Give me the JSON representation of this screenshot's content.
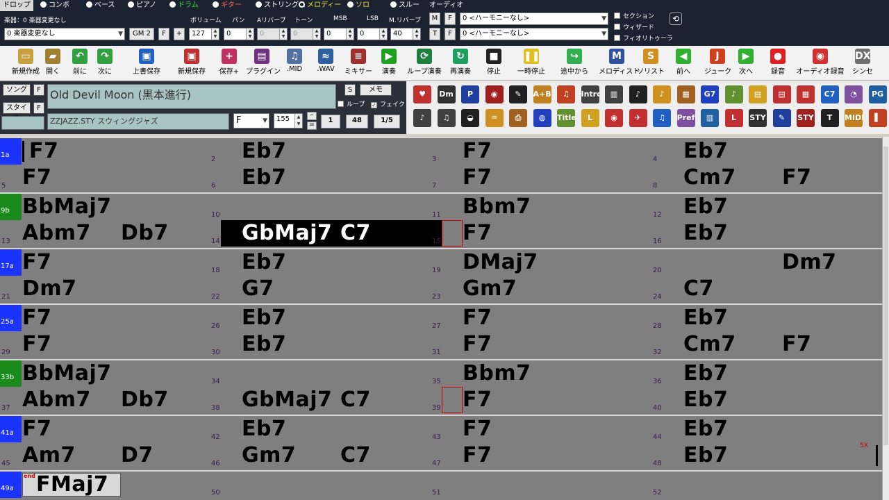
{
  "tracks": {
    "items": [
      {
        "label": "ドロップ",
        "selected": true
      },
      {
        "label": "コンボ"
      },
      {
        "label": "ベース"
      },
      {
        "label": "ピアノ"
      },
      {
        "label": "ドラム"
      },
      {
        "label": "ギター"
      },
      {
        "label": "ストリングス"
      },
      {
        "label": "メロディー",
        "selected": true
      },
      {
        "label": "ソロ"
      },
      {
        "label": "スルー"
      }
    ],
    "audio_label": "オーディオ"
  },
  "instrument": {
    "label": "楽器：0 楽器変更なし",
    "select_value": "0 楽器変更なし",
    "gm_button": "GM 2",
    "f_button": "F",
    "plus_button": "+",
    "col_labels": [
      "ボリューム",
      "パン",
      "Aリバーブ",
      "トーン",
      "MSB",
      "LSB",
      "M.リバーブ"
    ],
    "values": [
      "127",
      "0",
      "0",
      "0",
      "0",
      "0",
      "40"
    ]
  },
  "harmony": {
    "m_button": "M",
    "t_button": "T",
    "f_button": "F",
    "select1": "0 <ハーモニーなし>",
    "select2": "0 <ハーモニーなし>",
    "checks": [
      "セクション",
      "ウィザード",
      "フィオリトゥーラ"
    ]
  },
  "toolbar": {
    "items": [
      {
        "label": "新規作成",
        "icon": "new-file-icon",
        "color": "#c8a040"
      },
      {
        "label": "開く",
        "icon": "open-folder-icon",
        "color": "#a08030"
      },
      {
        "label": "前に",
        "icon": "prev-song-icon",
        "color": "#30a040"
      },
      {
        "label": "次に",
        "icon": "next-song-icon",
        "color": "#30a040"
      },
      {
        "label": "上書保存",
        "icon": "save-icon",
        "color": "#2060c0"
      },
      {
        "label": "新規保存",
        "icon": "save-as-icon",
        "color": "#c03030"
      },
      {
        "label": "保存+",
        "icon": "save-plus-icon",
        "color": "#c03060"
      },
      {
        "label": "プラグイン",
        "icon": "daw-plugin-icon",
        "color": "#703080"
      },
      {
        "label": ".MID",
        "icon": "midi-file-icon",
        "color": "#5070a0"
      },
      {
        "label": ".WAV",
        "icon": "wav-file-icon",
        "color": "#3060a0"
      },
      {
        "label": "ミキサー",
        "icon": "mixer-icon",
        "color": "#a03030"
      },
      {
        "label": "演奏",
        "icon": "play-icon",
        "color": "#20a020"
      },
      {
        "label": "ループ演奏",
        "icon": "loop-play-icon",
        "color": "#208040"
      },
      {
        "label": "再演奏",
        "icon": "replay-icon",
        "color": "#20a060"
      },
      {
        "label": "停止",
        "icon": "stop-icon",
        "color": "#202020"
      },
      {
        "label": "一時停止",
        "icon": "pause-icon",
        "color": "#e0c020"
      },
      {
        "label": "途中から",
        "icon": "play-from-icon",
        "color": "#30b050"
      },
      {
        "label": "メロディスト",
        "icon": "melodist-icon",
        "color": "#3050a0"
      },
      {
        "label": "ソリスト",
        "icon": "soloist-icon",
        "color": "#d09020"
      },
      {
        "label": "前へ",
        "icon": "back-arrow-icon",
        "color": "#30b030"
      },
      {
        "label": "ジューク",
        "icon": "jukebox-icon",
        "color": "#d04020"
      },
      {
        "label": "次へ",
        "icon": "forward-arrow-icon",
        "color": "#30b030"
      },
      {
        "label": "録音",
        "icon": "record-icon",
        "color": "#e02020"
      },
      {
        "label": "オーディオ録音",
        "icon": "audio-record-icon",
        "color": "#d03030"
      },
      {
        "label": "シンセ",
        "icon": "synth-dxi-icon",
        "color": "#707070"
      }
    ]
  },
  "song": {
    "song_button": "ソング",
    "style_button": "スタイル",
    "f_button": "F",
    "title": "Old Devil Moon (黒本進行)",
    "style": "ZZJAZZ.STY スウィングジャズ",
    "s_button": "S",
    "memo_button": "メモ",
    "loop_label": "ループ",
    "fake_label": "フェイク",
    "key": "F",
    "tempo": "155",
    "start_bar": "1",
    "end_bar": "48",
    "choruses": "1/5"
  },
  "icon_grid": {
    "labels": [
      "Dm",
      "P",
      "A+B",
      "Intro",
      "G7",
      "C7",
      "PG",
      "Title",
      "L",
      "Pref",
      "STY",
      "MIDI"
    ]
  },
  "chords": {
    "repeat_marker": "5X",
    "end_marker": "end",
    "bars": [
      {
        "n": "1",
        "section": "1a",
        "chords": [
          "F7"
        ]
      },
      {
        "n": "2",
        "chords": [
          "Eb7"
        ]
      },
      {
        "n": "3",
        "chords": [
          "F7"
        ]
      },
      {
        "n": "4",
        "chords": [
          "Eb7"
        ]
      },
      {
        "n": "5",
        "chords": [
          "F7"
        ]
      },
      {
        "n": "6",
        "chords": [
          "Eb7"
        ]
      },
      {
        "n": "7",
        "chords": [
          "F7"
        ]
      },
      {
        "n": "8",
        "chords": [
          "Cm7",
          "F7"
        ]
      },
      {
        "n": "9",
        "section": "9b",
        "chords": [
          "BbMaj7"
        ]
      },
      {
        "n": "10",
        "chords": []
      },
      {
        "n": "11",
        "chords": [
          "Bbm7"
        ]
      },
      {
        "n": "12",
        "chords": [
          "Eb7"
        ]
      },
      {
        "n": "13",
        "chords": [
          "Abm7",
          "Db7"
        ]
      },
      {
        "n": "14",
        "chords": [
          "GbMaj7",
          "C7"
        ]
      },
      {
        "n": "15",
        "chords": [
          "F7"
        ]
      },
      {
        "n": "16",
        "chords": [
          "Eb7"
        ]
      },
      {
        "n": "17",
        "section": "17a",
        "chords": [
          "F7"
        ]
      },
      {
        "n": "18",
        "chords": [
          "Eb7"
        ]
      },
      {
        "n": "19",
        "chords": [
          "DMaj7"
        ]
      },
      {
        "n": "20",
        "chords": [
          "",
          "Dm7"
        ]
      },
      {
        "n": "21",
        "chords": [
          "Dm7"
        ]
      },
      {
        "n": "22",
        "chords": [
          "G7"
        ]
      },
      {
        "n": "23",
        "chords": [
          "Gm7"
        ]
      },
      {
        "n": "24",
        "chords": [
          "C7"
        ]
      },
      {
        "n": "25",
        "section": "25a",
        "chords": [
          "F7"
        ]
      },
      {
        "n": "26",
        "chords": [
          "Eb7"
        ]
      },
      {
        "n": "27",
        "chords": [
          "F7"
        ]
      },
      {
        "n": "28",
        "chords": [
          "Eb7"
        ]
      },
      {
        "n": "29",
        "chords": [
          "F7"
        ]
      },
      {
        "n": "30",
        "chords": [
          "Eb7"
        ]
      },
      {
        "n": "31",
        "chords": [
          "F7"
        ]
      },
      {
        "n": "32",
        "chords": [
          "Cm7",
          "F7"
        ]
      },
      {
        "n": "33",
        "section": "33b",
        "chords": [
          "BbMaj7"
        ]
      },
      {
        "n": "34",
        "chords": []
      },
      {
        "n": "35",
        "chords": [
          "Bbm7"
        ]
      },
      {
        "n": "36",
        "chords": [
          "Eb7"
        ]
      },
      {
        "n": "37",
        "chords": [
          "Abm7",
          "Db7"
        ]
      },
      {
        "n": "38",
        "chords": [
          "GbMaj7",
          "C7"
        ]
      },
      {
        "n": "39",
        "chords": [
          "F7"
        ]
      },
      {
        "n": "40",
        "chords": [
          "Eb7"
        ]
      },
      {
        "n": "41",
        "section": "41a",
        "chords": [
          "F7"
        ]
      },
      {
        "n": "42",
        "chords": [
          "Eb7"
        ]
      },
      {
        "n": "43",
        "chords": [
          "F7"
        ]
      },
      {
        "n": "44",
        "chords": [
          "Eb7"
        ]
      },
      {
        "n": "45",
        "chords": [
          "Am7",
          "D7"
        ]
      },
      {
        "n": "46",
        "chords": [
          "Gm7",
          "C7"
        ]
      },
      {
        "n": "47",
        "chords": [
          "F7"
        ]
      },
      {
        "n": "48",
        "chords": [
          "Eb7"
        ]
      },
      {
        "n": "49",
        "section": "49a",
        "chords": [
          "FMaj7"
        ]
      },
      {
        "n": "50",
        "chords": []
      },
      {
        "n": "51",
        "chords": []
      },
      {
        "n": "52",
        "chords": []
      }
    ]
  }
}
